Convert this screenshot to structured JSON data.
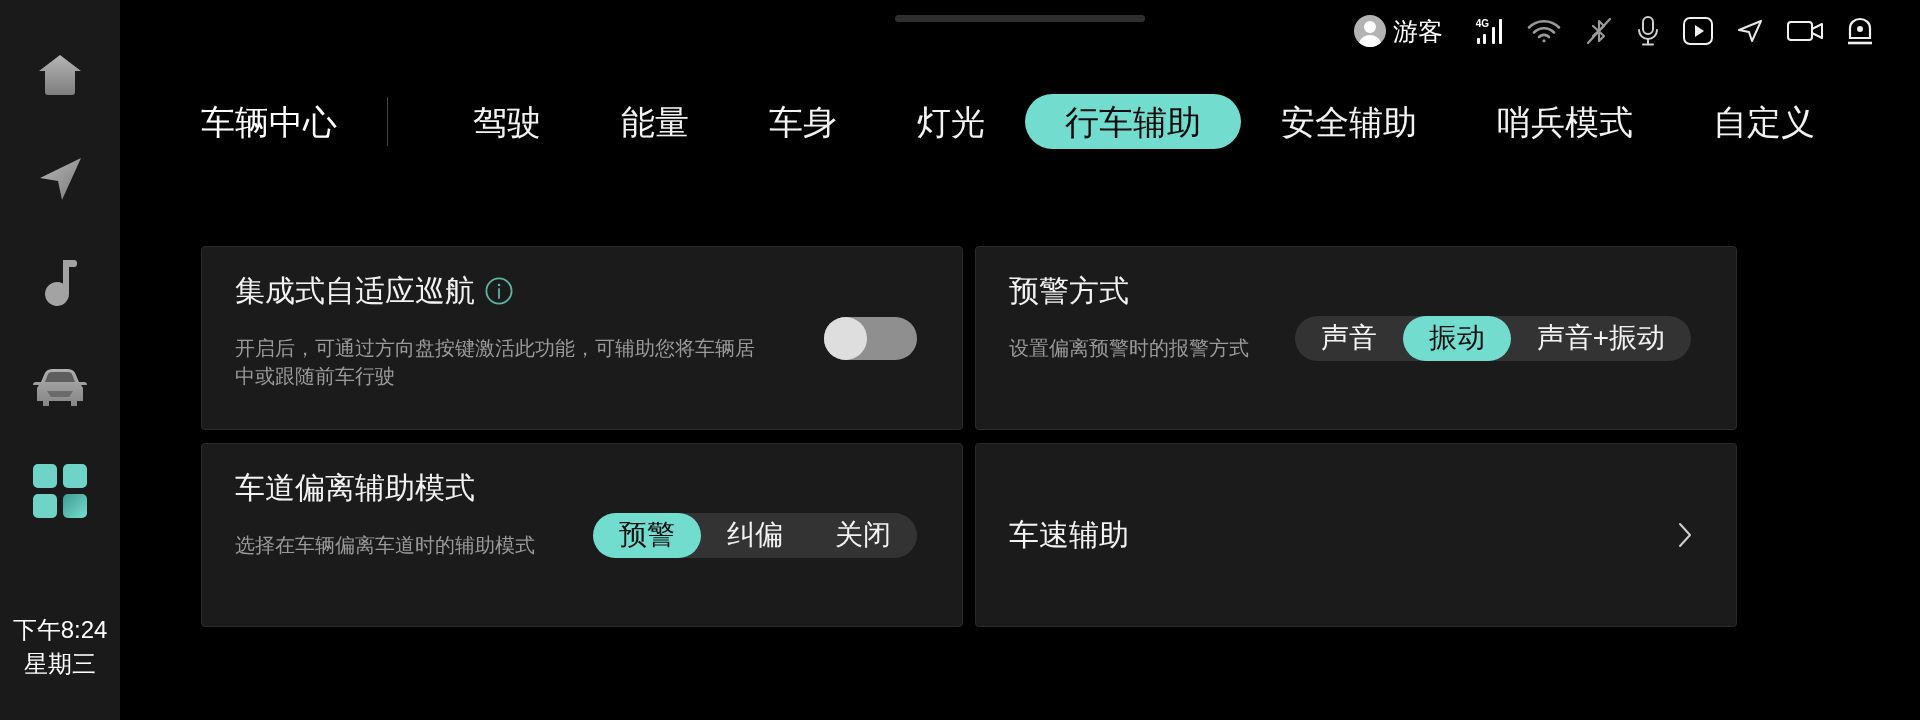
{
  "sidebar": {
    "time": "下午8:24",
    "weekday": "星期三"
  },
  "status_bar": {
    "user": "游客",
    "network": "4G"
  },
  "header": {
    "title": "车辆中心"
  },
  "tabs": [
    {
      "label": "驾驶",
      "selected": false
    },
    {
      "label": "能量",
      "selected": false
    },
    {
      "label": "车身",
      "selected": false
    },
    {
      "label": "灯光",
      "selected": false
    },
    {
      "label": "行车辅助",
      "selected": true
    },
    {
      "label": "安全辅助",
      "selected": false
    },
    {
      "label": "哨兵模式",
      "selected": false
    },
    {
      "label": "自定义",
      "selected": false
    }
  ],
  "cards": [
    {
      "kind": "toggle",
      "title": "集成式自适应巡航",
      "info": true,
      "description": "开启后，可通过方向盘按键激活此功能，可辅助您将车辆居中或跟随前车行驶",
      "on": false
    },
    {
      "kind": "options",
      "title": "预警方式",
      "description": "设置偏离预警时的报警方式",
      "options": [
        {
          "label": "声音",
          "selected": false
        },
        {
          "label": "振动",
          "selected": true
        },
        {
          "label": "声音+振动",
          "selected": false
        }
      ]
    },
    {
      "kind": "options",
      "title": "车道偏离辅助模式",
      "description": "选择在车辆偏离车道时的辅助模式",
      "options": [
        {
          "label": "预警",
          "selected": true
        },
        {
          "label": "纠偏",
          "selected": false
        },
        {
          "label": "关闭",
          "selected": false
        }
      ]
    },
    {
      "kind": "link",
      "title": "车速辅助"
    }
  ]
}
